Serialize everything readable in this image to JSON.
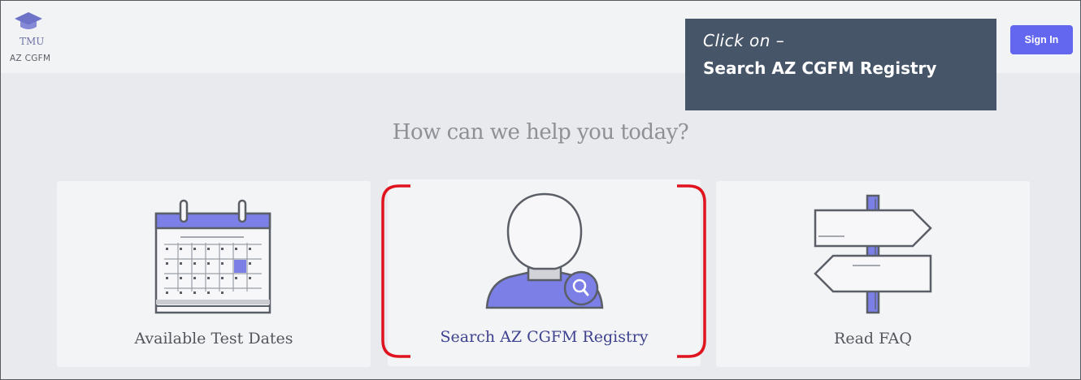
{
  "header": {
    "logo_text": "TMU",
    "logo_subtext": "AZ CGFM",
    "sign_in_label": "Sign In"
  },
  "callout": {
    "line1": "Click on –",
    "line2": "Search AZ CGFM Registry"
  },
  "main": {
    "heading": "How can we help you today?",
    "cards": [
      {
        "label": "Available Test Dates",
        "icon": "calendar-icon"
      },
      {
        "label": "Search AZ CGFM Registry",
        "icon": "person-search-icon"
      },
      {
        "label": "Read FAQ",
        "icon": "signpost-icon"
      }
    ]
  },
  "colors": {
    "accent": "#6367f0",
    "callout_bg": "#475568",
    "highlight": "#e0141e",
    "illustration_fill": "#7b7fe6"
  }
}
